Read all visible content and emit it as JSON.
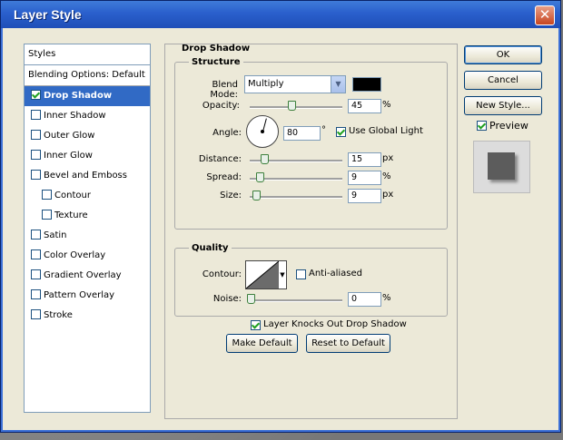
{
  "window": {
    "title": "Layer Style"
  },
  "styles_list": {
    "header": "Styles",
    "blending_options": "Blending Options: Default",
    "items": [
      {
        "label": "Drop Shadow",
        "checked": true,
        "selected": true,
        "indent": false
      },
      {
        "label": "Inner Shadow",
        "checked": false,
        "selected": false,
        "indent": false
      },
      {
        "label": "Outer Glow",
        "checked": false,
        "selected": false,
        "indent": false
      },
      {
        "label": "Inner Glow",
        "checked": false,
        "selected": false,
        "indent": false
      },
      {
        "label": "Bevel and Emboss",
        "checked": false,
        "selected": false,
        "indent": false
      },
      {
        "label": "Contour",
        "checked": false,
        "selected": false,
        "indent": true
      },
      {
        "label": "Texture",
        "checked": false,
        "selected": false,
        "indent": true
      },
      {
        "label": "Satin",
        "checked": false,
        "selected": false,
        "indent": false
      },
      {
        "label": "Color Overlay",
        "checked": false,
        "selected": false,
        "indent": false
      },
      {
        "label": "Gradient Overlay",
        "checked": false,
        "selected": false,
        "indent": false
      },
      {
        "label": "Pattern Overlay",
        "checked": false,
        "selected": false,
        "indent": false
      },
      {
        "label": "Stroke",
        "checked": false,
        "selected": false,
        "indent": false
      }
    ]
  },
  "drop_shadow": {
    "title": "Drop Shadow",
    "structure": {
      "title": "Structure",
      "blend_mode_label": "Blend Mode:",
      "blend_mode_value": "Multiply",
      "shadow_color": "#000000",
      "opacity_label": "Opacity:",
      "opacity_value": "45",
      "opacity_unit": "%",
      "opacity_percent": 45,
      "angle_label": "Angle:",
      "angle_value": "80",
      "angle_unit": "°",
      "use_global_light_label": "Use Global Light",
      "use_global_light_checked": true,
      "distance_label": "Distance:",
      "distance_value": "15",
      "distance_unit": "px",
      "spread_label": "Spread:",
      "spread_value": "9",
      "spread_unit": "%",
      "size_label": "Size:",
      "size_value": "9",
      "size_unit": "px"
    },
    "quality": {
      "title": "Quality",
      "contour_label": "Contour:",
      "anti_aliased_label": "Anti-aliased",
      "anti_aliased_checked": false,
      "noise_label": "Noise:",
      "noise_value": "0",
      "noise_unit": "%"
    },
    "layer_knocks_out_label": "Layer Knocks Out Drop Shadow",
    "layer_knocks_out_checked": true,
    "make_default_label": "Make Default",
    "reset_default_label": "Reset to Default"
  },
  "buttons": {
    "ok": "OK",
    "cancel": "Cancel",
    "new_style": "New Style...",
    "preview_label": "Preview",
    "preview_checked": true
  }
}
